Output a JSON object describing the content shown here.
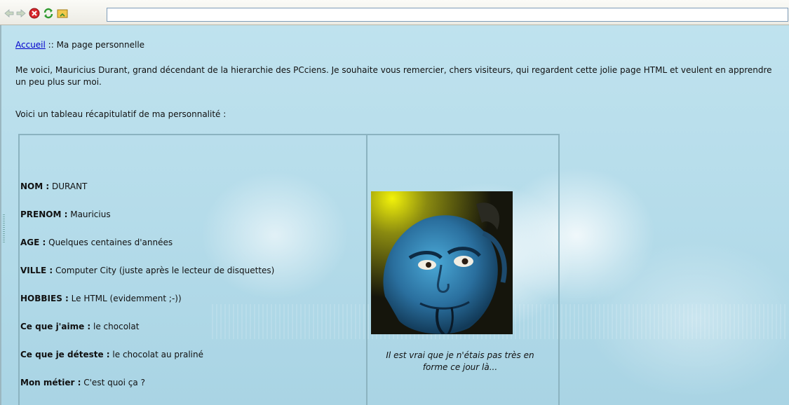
{
  "toolbar": {
    "icons": [
      "back-arrow-icon",
      "forward-arrow-icon",
      "stop-icon",
      "refresh-icon",
      "home-folder-icon"
    ],
    "address_value": ""
  },
  "page": {
    "breadcrumb": {
      "home_link": "Accueil",
      "separator": " :: ",
      "current": "Ma page personnelle"
    },
    "intro": "Me voici, Mauricius Durant, grand décendant de la hierarchie des PCciens. Je souhaite vous remercier, chers visiteurs, qui regardent cette jolie page HTML et veulent en apprendre un peu plus sur moi.",
    "summary": "Voici un tableau récapitulatif de ma personnalité :",
    "profile": [
      {
        "label": "NOM :",
        "value": " DURANT"
      },
      {
        "label": "PRENOM :",
        "value": " Mauricius"
      },
      {
        "label": "AGE :",
        "value": " Quelques centaines d'années"
      },
      {
        "label": "VILLE :",
        "value": " Computer City (juste après le lecteur de disquettes)"
      },
      {
        "label": "HOBBIES :",
        "value": " Le HTML (evidemment ;-))"
      },
      {
        "label": "Ce que j'aime :",
        "value": " le chocolat"
      },
      {
        "label": "Ce que je déteste :",
        "value": " le chocolat au praliné"
      },
      {
        "label": "Mon métier :",
        "value": " C'est quoi ça ?"
      }
    ],
    "caption_line1": "Il est vrai que je n'étais pas très en",
    "caption_line2": "forme ce jour là..."
  },
  "colors": {
    "link": "#0000cc",
    "page_bg": "#bfe2ee",
    "table_border": "#8bb3c0"
  }
}
